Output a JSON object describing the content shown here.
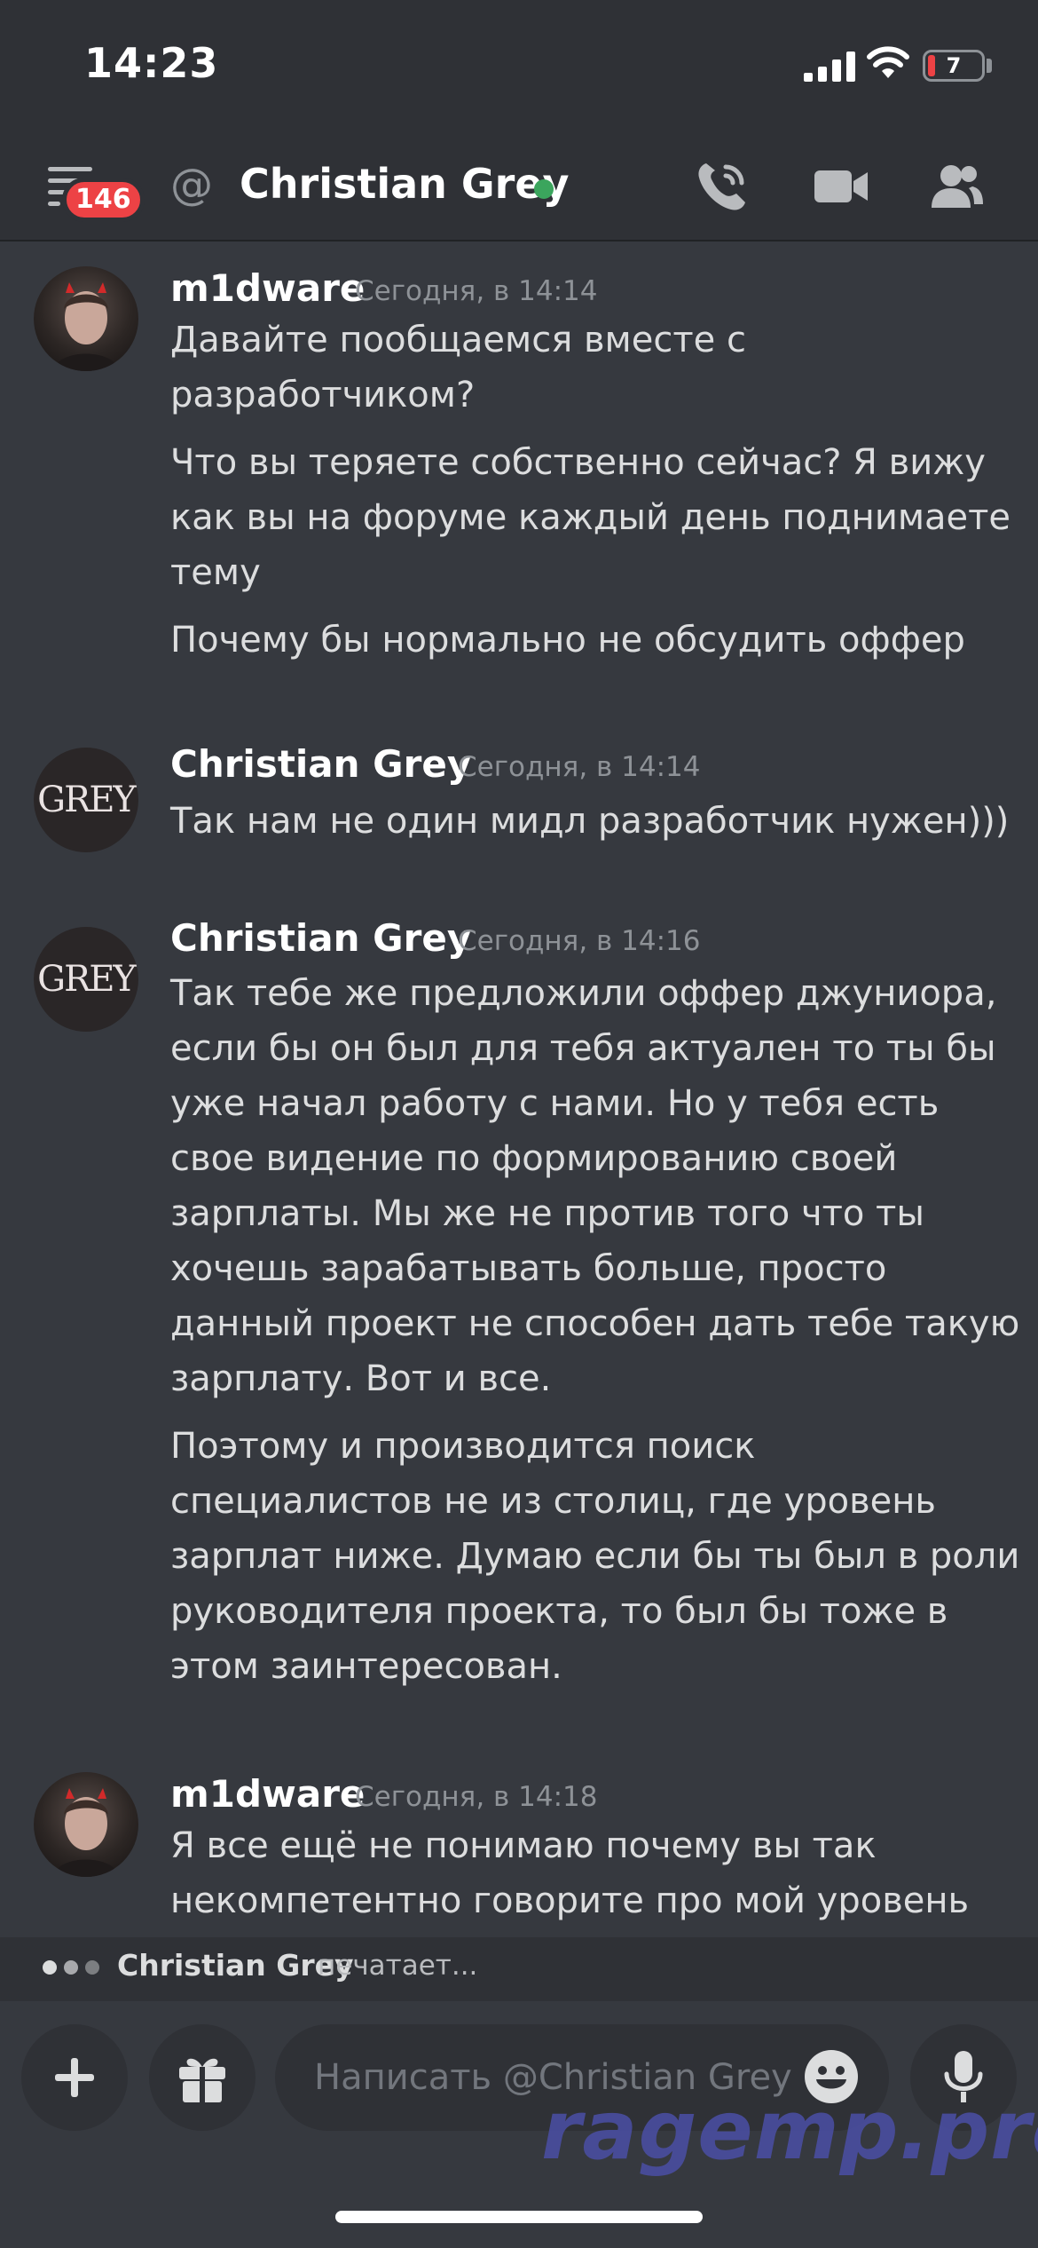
{
  "status_bar": {
    "time": "14:23",
    "battery": "7"
  },
  "header": {
    "menu_badge": "146",
    "title": "Christian Grey",
    "at_symbol": "@",
    "icons": [
      "menu-icon",
      "at-icon",
      "phone-call-icon",
      "video-camera-icon",
      "members-icon"
    ],
    "status_color": "#3ba55d"
  },
  "messages": [
    {
      "author": "m1dware",
      "timestamp": "Сегодня, в 14:14",
      "avatar": "photo",
      "paragraphs": [
        "Давайте пообщаемся вместе с разработчиком?",
        "Что вы теряете собственно сейчас? Я вижу как вы на форуме каждый день поднимаете тему",
        "Почему бы нормально не обсудить оффер"
      ]
    },
    {
      "author": "Christian Grey",
      "timestamp": "Сегодня, в 14:14",
      "avatar": "GREY",
      "paragraphs": [
        "Так нам не один мидл разработчик нужен)))"
      ]
    },
    {
      "author": "Christian Grey",
      "timestamp": "Сегодня, в 14:16",
      "avatar": "GREY",
      "paragraphs": [
        "Так тебе же предложили оффер джуниора, если бы он был для тебя актуален то ты бы уже начал работу с нами. Но у тебя есть свое видение по формированию своей зарплаты. Мы же не против того что ты хочешь зарабатывать больше, просто данный проект не способен дать тебе такую зарплату. Вот и все.",
        "Поэтому и производится поиск специалистов не из столиц, где уровень зарплат ниже. Думаю если бы ты был в роли руководителя проекта, то был бы тоже  в этом заинтересован."
      ]
    },
    {
      "author": "m1dware",
      "timestamp": "Сегодня, в 14:18",
      "avatar": "photo",
      "paragraphs": [
        "Я все ещё не понимаю почему вы так некомпетентно говорите про мой уровень"
      ]
    }
  ],
  "typing": {
    "name": "Christian Grey",
    "text": "печатает..."
  },
  "composer": {
    "placeholder": "Написать @Christian Grey",
    "icons": [
      "plus-icon",
      "gift-icon",
      "emoji-icon",
      "microphone-icon"
    ]
  },
  "watermark": "ragemp.pro",
  "colors": {
    "background": "#36393f",
    "header": "#2f3136",
    "badge": "#ed4245",
    "accent_watermark": "#4b4fa6"
  }
}
